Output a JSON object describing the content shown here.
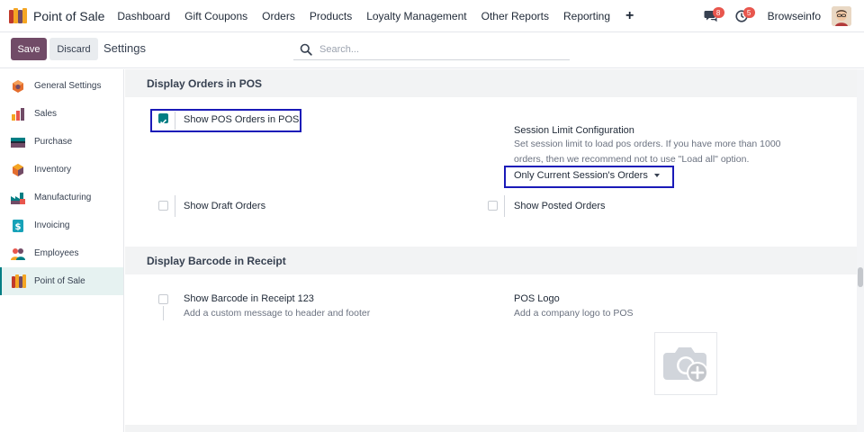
{
  "app": {
    "name": "Point of Sale"
  },
  "nav": {
    "items": [
      "Dashboard",
      "Gift Coupons",
      "Orders",
      "Products",
      "Loyalty Management",
      "Other Reports",
      "Reporting"
    ],
    "plus_icon": "+",
    "messages_badge": "8",
    "activities_badge": "5",
    "user_name": "Browseinfo"
  },
  "control": {
    "save_label": "Save",
    "discard_label": "Discard",
    "title": "Settings",
    "search_placeholder": "Search..."
  },
  "sidebar": {
    "items": [
      {
        "label": "General Settings",
        "icon": "general-settings-icon"
      },
      {
        "label": "Sales",
        "icon": "sales-icon"
      },
      {
        "label": "Purchase",
        "icon": "purchase-icon"
      },
      {
        "label": "Inventory",
        "icon": "inventory-icon"
      },
      {
        "label": "Manufacturing",
        "icon": "manufacturing-icon"
      },
      {
        "label": "Invoicing",
        "icon": "invoicing-icon"
      },
      {
        "label": "Employees",
        "icon": "employees-icon"
      },
      {
        "label": "Point of Sale",
        "icon": "point-of-sale-icon",
        "active": true
      }
    ]
  },
  "section1": {
    "title": "Display Orders in POS",
    "show_pos_orders": {
      "label": "Show POS Orders in POS",
      "checked": true
    },
    "session_limit": {
      "title": "Session Limit Configuration",
      "description": "Set session limit to load pos orders. If you have more than 1000 orders, then we recommend not to use \"Load all\" option.",
      "selected": "Only Current Session's Orders"
    },
    "show_draft_orders": {
      "label": "Show Draft Orders",
      "checked": false
    },
    "show_posted_orders": {
      "label": "Show Posted Orders",
      "checked": false
    }
  },
  "section2": {
    "title": "Display Barcode in Receipt",
    "show_barcode": {
      "label": "Show Barcode in Receipt 123",
      "description": "Add a custom message to header and footer",
      "checked": false
    },
    "pos_logo": {
      "title": "POS Logo",
      "description": "Add a company logo to POS"
    }
  },
  "colors": {
    "primary": "#714b67",
    "accent": "#017e84",
    "highlight_border": "#1a1ab8",
    "badge": "#e8564d"
  }
}
